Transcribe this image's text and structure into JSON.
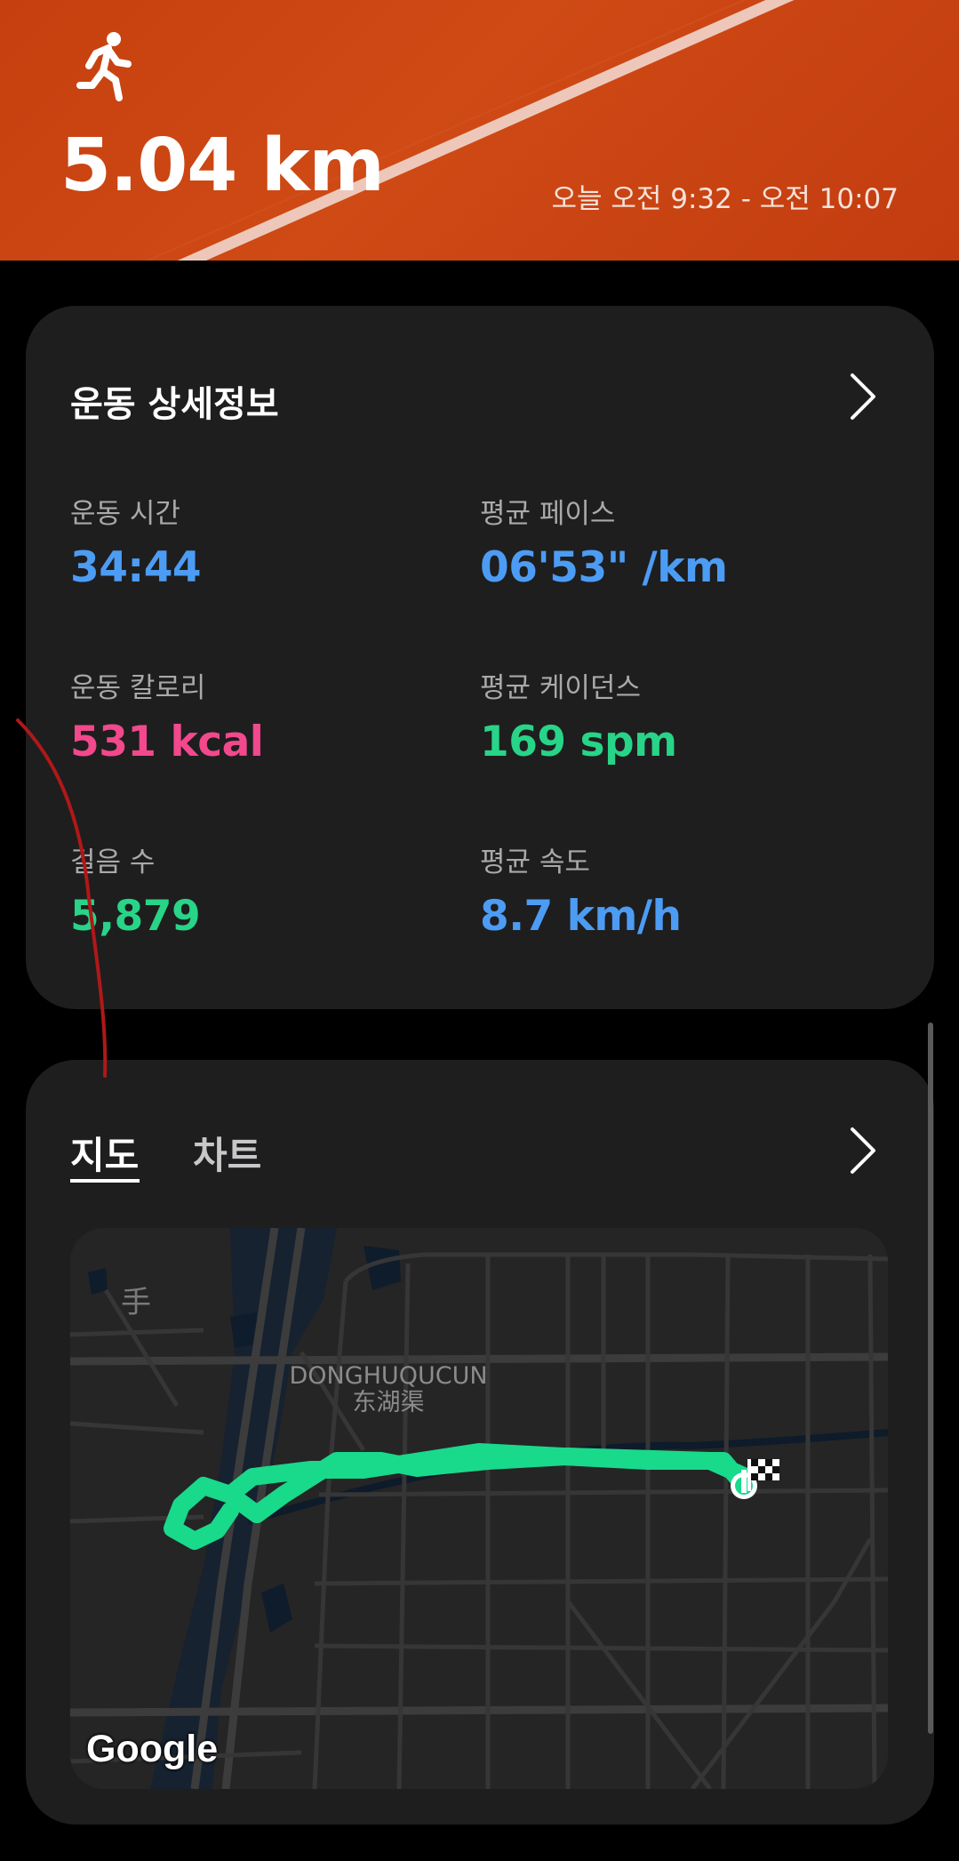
{
  "header": {
    "activity_icon": "running-person-icon",
    "distance": "5.04 km",
    "time_range": "오늘 오전 9:32 - 오전 10:07"
  },
  "details": {
    "title": "운동 상세정보",
    "stats": [
      {
        "label": "운동 시간",
        "value": "34:44",
        "color": "#4c9cf4"
      },
      {
        "label": "평균 페이스",
        "value": "06'53\" /km",
        "color": "#4c9cf4"
      },
      {
        "label": "운동 칼로리",
        "value": "531 kcal",
        "color": "#f2488c"
      },
      {
        "label": "평균 케이던스",
        "value": "169 spm",
        "color": "#28d487"
      },
      {
        "label": "걸음 수",
        "value": "5,879",
        "color": "#28d487"
      },
      {
        "label": "평균 속도",
        "value": "8.7 km/h",
        "color": "#4c9cf4"
      }
    ]
  },
  "map_card": {
    "tabs": [
      "지도",
      "차트"
    ],
    "active_tab": "지도",
    "map_place_en": "DONGHUQUCUN",
    "map_place_cn": "东湖渠",
    "map_char": "手",
    "map_attribution": "Google",
    "route_color": "#19d98b"
  }
}
